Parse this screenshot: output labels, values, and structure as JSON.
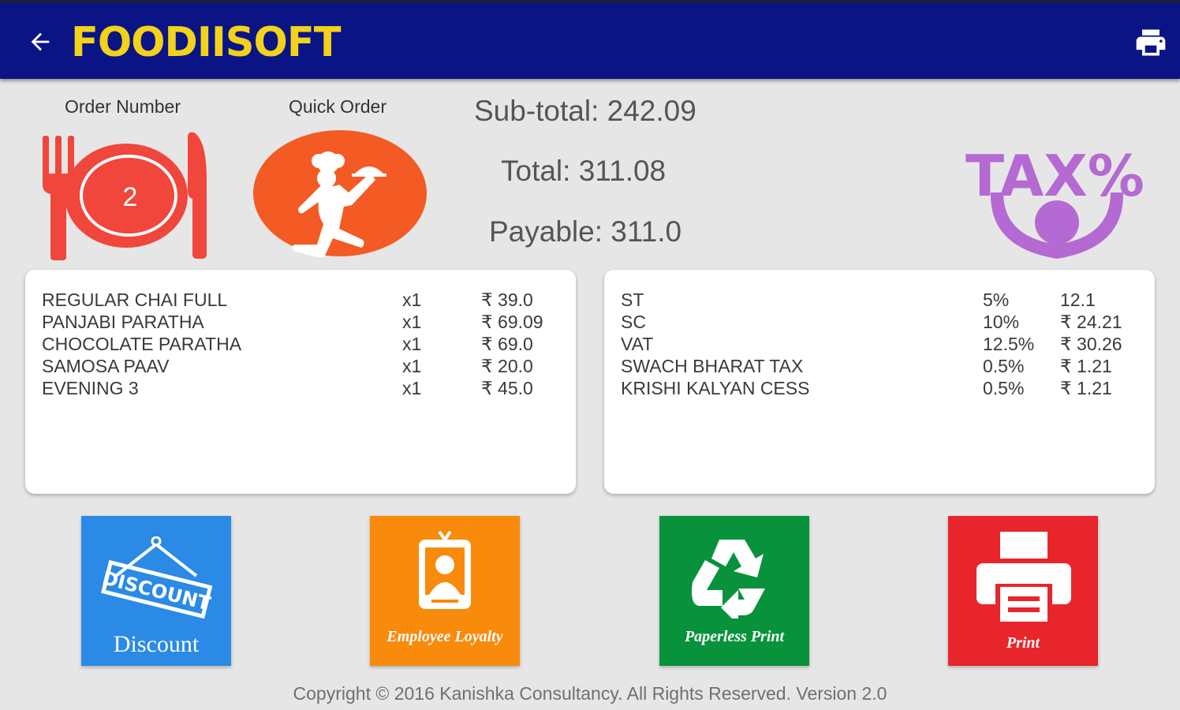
{
  "app": {
    "name": "FOODIISOFT",
    "colors": {
      "appbar": "#0a1485",
      "logo": "#f2d21a",
      "accent_orange": "#f45a23",
      "plate_red": "#f0463c",
      "tax_purple": "#b46ad2"
    }
  },
  "header": {
    "back_icon": "arrow-back-icon",
    "print_icon": "printer-icon"
  },
  "order_number": {
    "label": "Order Number",
    "value": "2"
  },
  "quick_order": {
    "label": "Quick Order"
  },
  "totals": {
    "subtotal": "Sub-total: 242.09",
    "total": "Total: 311.08",
    "payable": "Payable: 311.0"
  },
  "tax_logo_text": "TAX%",
  "items": [
    {
      "name": "REGULAR CHAI FULL",
      "qty": "x1",
      "price": "₹ 39.0"
    },
    {
      "name": "PANJABI PARATHA",
      "qty": "x1",
      "price": "₹ 69.09"
    },
    {
      "name": "CHOCOLATE PARATHA",
      "qty": "x1",
      "price": "₹ 69.0"
    },
    {
      "name": "SAMOSA PAAV",
      "qty": "x1",
      "price": "₹ 20.0"
    },
    {
      "name": "EVENING 3",
      "qty": "x1",
      "price": "₹ 45.0"
    }
  ],
  "taxes": [
    {
      "name": "ST",
      "rate": "5%",
      "amount": "12.1"
    },
    {
      "name": "SC",
      "rate": "10%",
      "amount": "₹ 24.21"
    },
    {
      "name": "VAT",
      "rate": "12.5%",
      "amount": "₹ 30.26"
    },
    {
      "name": "SWACH BHARAT TAX",
      "rate": "0.5%",
      "amount": "₹ 1.21"
    },
    {
      "name": "KRISHI KALYAN CESS",
      "rate": "0.5%",
      "amount": "₹ 1.21"
    }
  ],
  "actions": {
    "discount": {
      "label": "Discount",
      "sign_text": "DISCOUNT",
      "color": "#2a8ae6"
    },
    "loyalty": {
      "label": "Employee Loyalty",
      "color": "#f88a0c"
    },
    "paperless": {
      "label": "Paperless Print",
      "color": "#09923c"
    },
    "print": {
      "label": "Print",
      "color": "#e8252a"
    }
  },
  "footer": {
    "text": "Copyright © 2016 Kanishka Consultancy. All Rights Reserved. Version 2.0"
  }
}
